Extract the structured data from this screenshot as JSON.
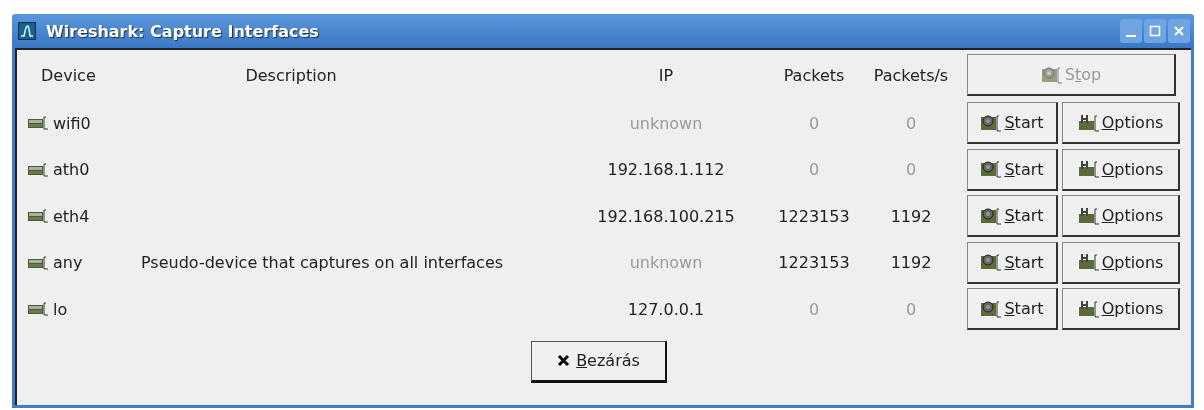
{
  "window": {
    "title": "Wireshark: Capture Interfaces"
  },
  "columns": [
    "Device",
    "Description",
    "IP",
    "Packets",
    "Packets/s"
  ],
  "stop_button": {
    "label": {
      "before": "S",
      "key": "t",
      "after": "op"
    },
    "disabled": true
  },
  "interfaces": [
    {
      "device": "wifi0",
      "ip": "unknown",
      "ip_dim": true,
      "packets": "0",
      "packets_dim": true,
      "rate": "0",
      "rate_dim": true,
      "start": {
        "key": "S",
        "after": "tart"
      },
      "options": {
        "key": "O",
        "after": "ptions"
      }
    },
    {
      "device": "ath0",
      "ip": "192.168.1.112",
      "ip_dim": false,
      "packets": "0",
      "packets_dim": true,
      "rate": "0",
      "rate_dim": true,
      "start": {
        "key": "S",
        "after": "tart"
      },
      "options": {
        "key": "O",
        "after": "ptions"
      }
    },
    {
      "device": "eth4",
      "ip": "192.168.100.215",
      "ip_dim": false,
      "packets": "1223153",
      "packets_dim": false,
      "rate": "1192",
      "rate_dim": false,
      "start": {
        "key": "S",
        "after": "tart"
      },
      "options": {
        "key": "O",
        "after": "ptions"
      }
    },
    {
      "device": "any",
      "description": "Pseudo-device that captures on all interfaces",
      "ip": "unknown",
      "ip_dim": true,
      "packets": "1223153",
      "packets_dim": false,
      "rate": "1192",
      "rate_dim": false,
      "start": {
        "key": "S",
        "after": "tart"
      },
      "options": {
        "key": "O",
        "after": "ptions"
      }
    },
    {
      "device": "lo",
      "ip": "127.0.0.1",
      "ip_dim": false,
      "packets": "0",
      "packets_dim": true,
      "rate": "0",
      "rate_dim": true,
      "start": {
        "key": "S",
        "after": "tart"
      },
      "options": {
        "key": "O",
        "after": "ptions"
      }
    }
  ],
  "close_button": {
    "key": "B",
    "after": "ezárás"
  }
}
